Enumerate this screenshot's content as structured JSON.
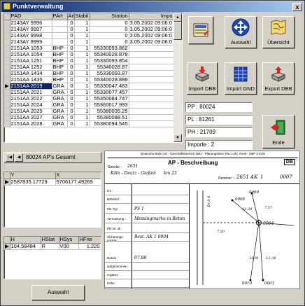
{
  "window": {
    "title": "Punktverwaltung",
    "close_glyph": "x"
  },
  "points_table": {
    "columns": [
      "PAD",
      "PArt",
      "Art",
      "Stabil",
      "Station",
      "Impo"
    ],
    "rows": [
      [
        "2143AY 9996",
        "",
        "0",
        "1",
        "0",
        "3.05.2002 09:06:0"
      ],
      [
        "2143AY 9997",
        "",
        "0",
        "1",
        "0",
        "3.05.2002 09:06:0"
      ],
      [
        "2143AY 9998",
        "",
        "0",
        "1",
        "0",
        "3.05.2002 09:06:0"
      ],
      [
        "2143AY 9999",
        "",
        "0",
        "1",
        "0",
        "3.05.2002 09:06:0"
      ],
      [
        "2151AA 1053",
        "BHP",
        "0",
        "1",
        "55330093.862",
        ""
      ],
      [
        "2151AA 1054",
        "BHP",
        "0",
        "1",
        "55340028.878",
        ""
      ],
      [
        "2151AA 1251",
        "BHP",
        "0",
        "1",
        "55330093.854",
        ""
      ],
      [
        "2151AA 1252",
        "BHP",
        "0",
        "1",
        "55340028.87",
        ""
      ],
      [
        "2151AA 1434",
        "BHP",
        "0",
        "1",
        "55330093.87",
        ""
      ],
      [
        "2151AA 1435",
        "BHP",
        "0",
        "1",
        "55340028.886",
        ""
      ],
      [
        "2151AA 2019",
        "GRA",
        "0",
        "1",
        "55330047.483",
        ""
      ],
      [
        "2151AA 2021",
        "GRA",
        "0",
        "1",
        "55330077.457",
        ""
      ],
      [
        "2151AA 2022",
        "GRA",
        "0",
        "1",
        "55350084.747",
        ""
      ],
      [
        "2151AA 2024",
        "GRA",
        "0",
        "1",
        "55360017.993",
        ""
      ],
      [
        "2151AA 2025",
        "GRA",
        "0",
        "1",
        "55380035.25",
        ""
      ],
      [
        "2151AA 2027",
        "GRA",
        "0",
        "1",
        "55380088.51",
        ""
      ],
      [
        "2151AA 2028",
        "GRA",
        "0",
        "1",
        "55380094.545",
        ""
      ]
    ],
    "selected_index": 10
  },
  "buttons": {
    "auswahl": "Auswahl",
    "uebersicht": "Übersicht",
    "import_dbb": "Import DBB",
    "import_gnd": "Import GND",
    "export_dbb": "Export DBB",
    "ende": "Ende",
    "auswahl_bottom": "Auswahl"
  },
  "fields": {
    "pp": "PP : 80024",
    "pl": "PL : 81261",
    "ph": "PH : 21709",
    "importe": "Importe : 2"
  },
  "navigator": {
    "label": "80024 AP's Gesamt",
    "first_glyph": "|◀",
    "prev_glyph": "◀"
  },
  "coord_table": {
    "columns": [
      "Y",
      "X"
    ],
    "rows": [
      [
        "2587835.17729",
        "5706177.49269"
      ]
    ]
  },
  "height_table": {
    "columns": [
      "H",
      "HStat",
      "HSys",
      "HFrei"
    ],
    "rows": [
      [
        "104.58484",
        "R",
        "V00",
        "1.220"
      ]
    ]
  },
  "document": {
    "header": "Deutsche Bahn AG - Geschäftsbereich Netz - Planungsbüro Pat. Lehr Yvest - KBF 3 Köln",
    "title": "AP - Beschreibung",
    "badge": "DB",
    "strecke_label": "Strecke :",
    "strecke_value": "2651",
    "strecke_sub": "Köln - Deutz - Gießen",
    "km": "km 25",
    "nummer_label": "Nummer :",
    "nummer_value": "2651 AK",
    "nr_value": "1",
    "pl_value": "0007",
    "rows": [
      {
        "label": "km :",
        "value": ""
      },
      {
        "label": "Bahnhof :",
        "value": ""
      },
      {
        "label": "Pkt.Typ :",
        "value": "PS 1"
      },
      {
        "label": "Vermarkung :",
        "value": "Messingmarke in Beton"
      },
      {
        "label": "Pkt.Nr. alt :",
        "value": ""
      },
      {
        "label": "Sicherungs-punkte :",
        "value": "Best. AK  1 0004"
      },
      {
        "label": "Datum :",
        "value": "07.98"
      },
      {
        "label": "aufgenommen :",
        "value": ""
      },
      {
        "label": "ergänzt :",
        "value": ""
      },
      {
        "label": "Höhe :",
        "value": ""
      }
    ],
    "sketch_labels": {
      "p1": "0008",
      "p2": "0009",
      "p3": "0004",
      "p4": "0010",
      "p5": "0003",
      "d1": "7,50",
      "d2": "13,39",
      "d3": "7,57",
      "d4": "12,01",
      "d5": "13,34",
      "side": "Zn 8 6"
    }
  },
  "colors": {
    "title_start": "#0a246a",
    "title_end": "#a6caf0",
    "selection": "#0a246a"
  }
}
